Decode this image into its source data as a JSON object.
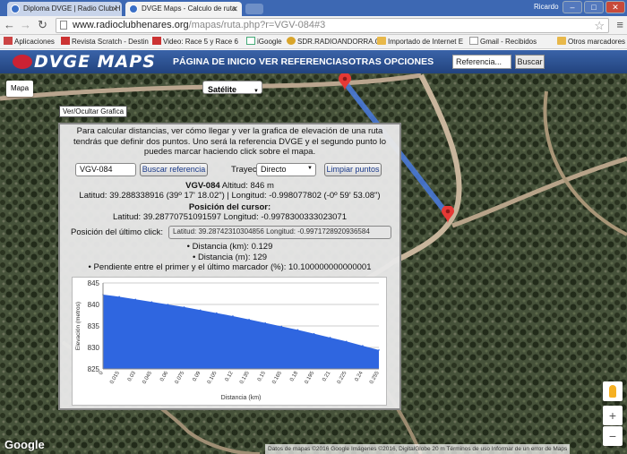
{
  "browser": {
    "tabs": [
      {
        "title": "Diploma DVGE | Radio Club H"
      },
      {
        "title": "DVGE Maps - Calculo de ruta"
      }
    ],
    "user": "Ricardo",
    "url_host": "www.radioclubhenares.org",
    "url_path": "/mapas/ruta.php?r=VGV-084#3",
    "bookmarks": [
      {
        "label": "Aplicaciones",
        "icon": "apps-icon"
      },
      {
        "label": "Revista Scratch - Destin",
        "icon": "scratch-icon"
      },
      {
        "label": "Video: Race 5 y Race 6",
        "icon": "scratch-icon"
      },
      {
        "label": "iGoogle",
        "icon": "google-icon"
      },
      {
        "label": "SDR.RADIOANDORRA.C",
        "icon": "radio-icon"
      },
      {
        "label": "Importado de Internet E",
        "icon": "folder-icon"
      },
      {
        "label": "Gmail - Recibidos",
        "icon": "page-icon"
      },
      {
        "label": "Otros marcadores",
        "icon": "folder-icon"
      }
    ]
  },
  "site": {
    "logo": "DVGE MAPS",
    "nav": [
      "PÁGINA DE INICIO",
      "VER REFERENCIAS",
      "OTRAS OPCIONES"
    ],
    "search_value": "Referencia...",
    "search_button": "Buscar"
  },
  "map": {
    "type_buttons": [
      "Mapa",
      "Satélite"
    ],
    "toggle_chart": "Ver/Ocultar Grafica",
    "google": "Google",
    "attribution": "Datos de mapas ©2016 Google Imágenes ©2016, DigitalGlobe   20 m      Términos de uso    Informar de un error de Maps",
    "zoom_in": "+",
    "zoom_out": "−"
  },
  "panel": {
    "intro": "Para calcular distancias, ver cómo llegar y ver la grafica de elevación de una ruta tendrás que definir dos puntos. Uno será la referencia DVGE y el segundo punto lo puedes marcar haciendo click sobre el mapa.",
    "ref_value": "VGV-084",
    "buscar_ref": "Buscar referencia",
    "trayecto_label": "Trayecto:",
    "trayecto_value": "Directo",
    "limpiar": "Limpiar puntos",
    "ref_name": "VGV-084",
    "altitud": "Altitud: 846 m",
    "coords": "Latitud: 39.288338916 (39º 17' 18.02\") | Longitud: -0.998077802 (-0º 59' 53.08\")",
    "cursor_title": "Posición del cursor:",
    "cursor_coords": "Latitud: 39.28770751091597 Longitud: -0.9978300333023071",
    "last_label": "Posición del último click:",
    "last_value": "Latitud: 39.28742310304856 Longitud: -0.9971728920936584",
    "stats": [
      "Distancia (km): 0.129",
      "Distancia (m): 129",
      "Pendiente entre el primer y el último marcador (%): 10.100000000000001"
    ]
  },
  "chart_data": {
    "type": "area",
    "xlabel": "Distancia (km)",
    "ylabel": "Elevación (metros)",
    "ylim": [
      825,
      845
    ],
    "yticks": [
      825,
      830,
      835,
      840,
      845
    ],
    "x": [
      0,
      0.015,
      0.03,
      0.045,
      0.06,
      0.075,
      0.09,
      0.105,
      0.12,
      0.135,
      0.15,
      0.165,
      0.18,
      0.195,
      0.21,
      0.225,
      0.24,
      0.255
    ],
    "xticklabels": [
      "0",
      "0.015",
      "0.03",
      "0.045",
      "0.06",
      "0.075",
      "0.09",
      "0.105",
      "0.12",
      "0.135",
      "0.15",
      "0.165",
      "0.18",
      "0.195",
      "0.21",
      "0.225",
      "0.24",
      "0.255"
    ],
    "y": [
      842.3,
      841.8,
      841.2,
      840.6,
      840.0,
      839.4,
      838.7,
      838.0,
      837.3,
      836.5,
      835.7,
      834.9,
      834.1,
      833.2,
      832.3,
      831.4,
      830.4,
      829.4
    ],
    "color": "#2f66e0"
  }
}
